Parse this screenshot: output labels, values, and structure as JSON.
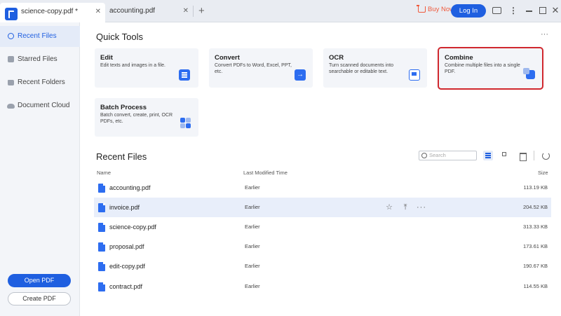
{
  "tabs": [
    {
      "label": "science-copy.pdf *",
      "active": true
    },
    {
      "label": "accounting.pdf",
      "active": false
    }
  ],
  "titlebar": {
    "buy_now": "Buy Now",
    "login": "Log In",
    "close_glyph": "✕",
    "new_tab_glyph": "+",
    "more_glyph": "⋮"
  },
  "sidebar": {
    "items": [
      {
        "label": "Recent Files",
        "icon": "clock-icon",
        "active": true
      },
      {
        "label": "Starred Files",
        "icon": "star-icon"
      },
      {
        "label": "Recent Folders",
        "icon": "folder-icon"
      },
      {
        "label": "Document Cloud",
        "icon": "cloud-icon"
      }
    ],
    "open_pdf": "Open PDF",
    "create_pdf": "Create PDF"
  },
  "quick_tools": {
    "title": "Quick Tools",
    "more_glyph": "···",
    "cards": [
      {
        "title": "Edit",
        "desc": "Edit texts and images in a file."
      },
      {
        "title": "Convert",
        "desc": "Convert PDFs to Word, Excel, PPT, etc."
      },
      {
        "title": "OCR",
        "desc": "Turn scanned documents into searchable or editable text."
      },
      {
        "title": "Combine",
        "desc": "Combine multiple files into a single PDF.",
        "highlighted": true
      },
      {
        "title": "Batch Process",
        "desc": "Batch convert, create, print, OCR PDFs, etc."
      }
    ]
  },
  "recent_files": {
    "title": "Recent Files",
    "search_placeholder": "Search",
    "columns": {
      "name": "Name",
      "modified": "Last Modified Time",
      "size": "Size"
    },
    "row_actions": {
      "star": "☆",
      "upload": "⤒",
      "more": "···"
    },
    "rows": [
      {
        "name": "accounting.pdf",
        "modified": "Earlier",
        "size": "113.19 KB"
      },
      {
        "name": "invoice.pdf",
        "modified": "Earlier",
        "size": "204.52 KB",
        "hovered": true
      },
      {
        "name": "science-copy.pdf",
        "modified": "Earlier",
        "size": "313.33 KB"
      },
      {
        "name": "proposal.pdf",
        "modified": "Earlier",
        "size": "173.61 KB"
      },
      {
        "name": "edit-copy.pdf",
        "modified": "Earlier",
        "size": "190.67 KB"
      },
      {
        "name": "contract.pdf",
        "modified": "Earlier",
        "size": "114.55 KB"
      }
    ]
  },
  "colors": {
    "accent": "#1f5fe0",
    "highlight": "#d0282e",
    "buy_now": "#f05a3c"
  }
}
